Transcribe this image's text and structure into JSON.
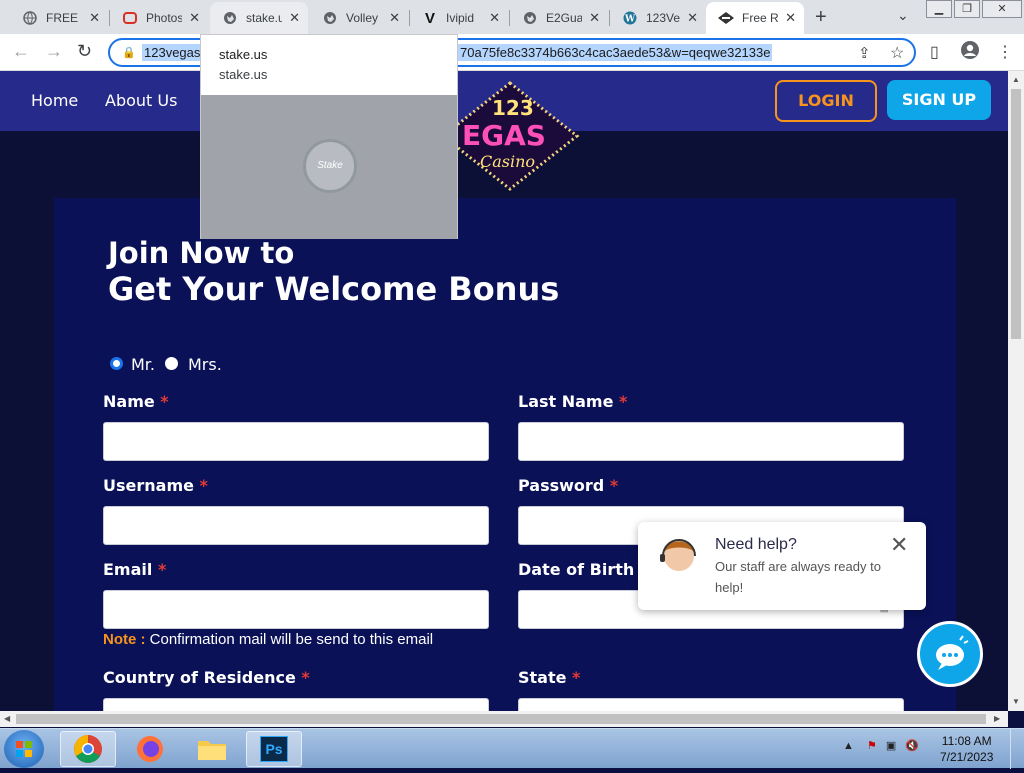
{
  "browser": {
    "tabs": [
      {
        "title": "FREE P",
        "icon": "globe-icon",
        "state": "normal"
      },
      {
        "title": "Photos",
        "icon": "photos-icon",
        "state": "normal"
      },
      {
        "title": "stake.u",
        "icon": "globe-icon",
        "state": "hover"
      },
      {
        "title": "Volley",
        "icon": "globe-icon",
        "state": "normal"
      },
      {
        "title": "Ivipid",
        "icon": "v-logo-icon",
        "state": "normal"
      },
      {
        "title": "E2Gua",
        "icon": "globe-icon",
        "state": "normal"
      },
      {
        "title": "123Ve",
        "icon": "wordpress-icon",
        "state": "normal"
      },
      {
        "title": "Free R",
        "icon": "casino-icon",
        "state": "active"
      }
    ],
    "close_glyph": "✕",
    "new_tab_glyph": "+",
    "url_part1": "123vegas",
    "url_part2": "70a75fe8c3374b663c4cac3aede53&w=qeqwe32133e",
    "hover_card": {
      "title": "stake.us",
      "domain": "stake.us",
      "thumb_text": "Stake"
    }
  },
  "site": {
    "nav": {
      "home": "Home",
      "about": "About Us",
      "login": "LOGIN",
      "signup": "SIGN UP"
    },
    "brand": {
      "line1": "123",
      "line2": "EGAS",
      "line3": "Casino"
    },
    "heading_line1": "Join Now to",
    "heading_line2": "Get Your Welcome Bonus",
    "salutation": {
      "mr": "Mr.",
      "mrs": "Mrs.",
      "selected": "Mr."
    },
    "fields": {
      "name": "Name",
      "last_name": "Last Name",
      "username": "Username",
      "password": "Password",
      "email": "Email",
      "dob": "Date of Birth",
      "country": "Country of Residence",
      "state": "State",
      "required_mark": "*"
    },
    "note_key": "Note :",
    "note_text": " Confirmation mail will be send to this email",
    "help": {
      "title": "Need help?",
      "text": "Our staff are always ready to help!"
    }
  },
  "taskbar": {
    "apps": [
      "chrome-icon",
      "firefox-icon",
      "folder-icon",
      "photoshop-icon"
    ],
    "photoshop_label": "Ps",
    "time": "11:08 AM",
    "date": "7/21/2023"
  },
  "colors": {
    "accent": "#f7941d",
    "signup": "#0ea5e9",
    "nav": "#262a8a",
    "form_bg": "#0a1157"
  }
}
